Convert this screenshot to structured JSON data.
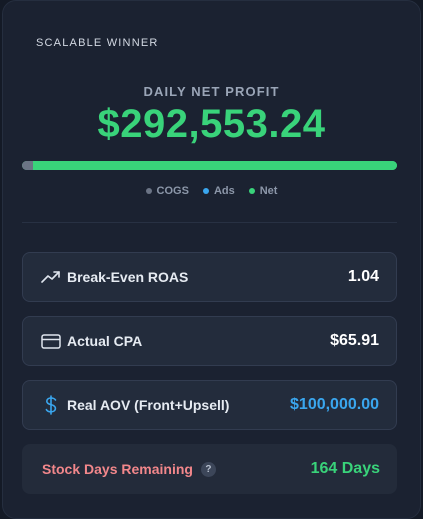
{
  "badge": "SCALABLE WINNER",
  "profit": {
    "label": "DAILY NET PROFIT",
    "value": "$292,553.24"
  },
  "breakdown": {
    "segments": [
      {
        "name": "COGS",
        "fraction": 0.03,
        "color": "#6b7485"
      },
      {
        "name": "Ads",
        "fraction": 0.0,
        "color": "#3aa6ee"
      },
      {
        "name": "Net",
        "fraction": 0.97,
        "color": "#39d37a"
      }
    ],
    "legend": [
      "COGS",
      "Ads",
      "Net"
    ]
  },
  "metrics": [
    {
      "label": "Break-Even ROAS",
      "value": "1.04",
      "icon": "trending-up-icon",
      "value_color": "#ffffff"
    },
    {
      "label": "Actual CPA",
      "value": "$65.91",
      "icon": "credit-card-icon",
      "value_color": "#ffffff"
    },
    {
      "label": "Real AOV (Front+Upsell)",
      "value": "$100,000.00",
      "icon": "dollar-icon",
      "value_color": "#3aa6ee"
    }
  ],
  "stock": {
    "label": "Stock Days Remaining",
    "help": "?",
    "value": "164 Days",
    "label_color": "#f2878b",
    "value_color": "#39d37a"
  }
}
